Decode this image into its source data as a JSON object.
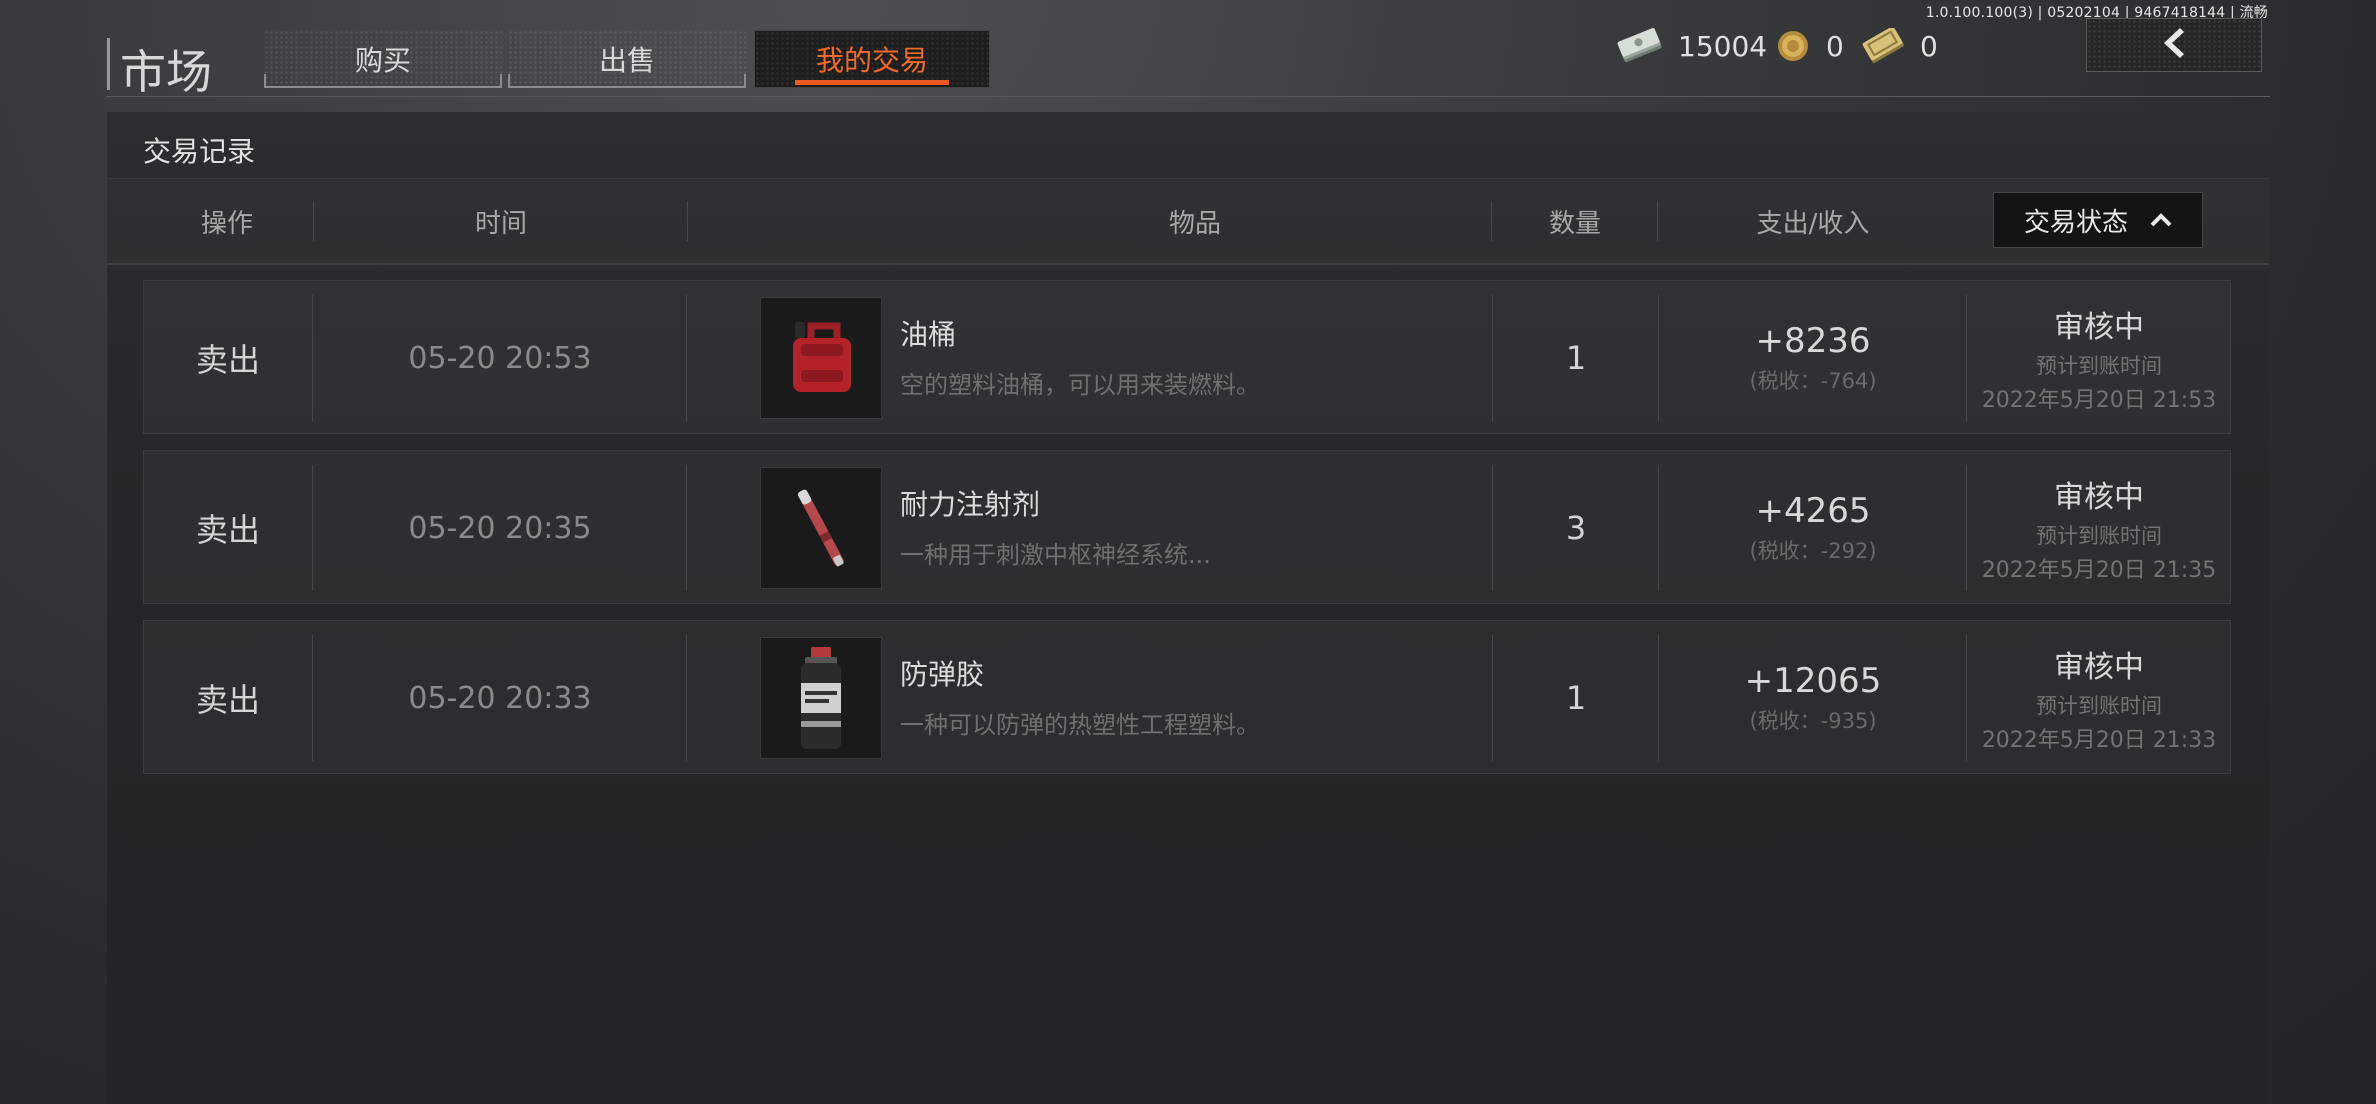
{
  "version_text": "1.0.100.100(3) | 05202104 | 9467418144 | 流畅",
  "header": {
    "title": "市场",
    "tabs": [
      {
        "label": "购买",
        "active": false
      },
      {
        "label": "出售",
        "active": false
      },
      {
        "label": "我的交易",
        "active": true
      }
    ],
    "currencies": [
      {
        "icon": "cash-stack-icon",
        "value": "15004"
      },
      {
        "icon": "gold-coin-icon",
        "value": "0"
      },
      {
        "icon": "gold-bill-icon",
        "value": "0"
      }
    ],
    "back_icon": "chevron-left-icon"
  },
  "panel": {
    "title": "交易记录",
    "columns": {
      "action": "操作",
      "time": "时间",
      "item": "物品",
      "quantity": "数量",
      "amount": "支出/收入",
      "status_filter": "交易状态"
    },
    "rows": [
      {
        "action": "卖出",
        "time": "05-20 20:53",
        "item_name": "油桶",
        "item_desc": "空的塑料油桶，可以用来装燃料。",
        "item_icon": "fuel-can-icon",
        "quantity": "1",
        "amount": "+8236",
        "tax": "(税收：-764)",
        "status": "审核中",
        "status_sub": "预计到账时间",
        "status_date": "2022年5月20日 21:53"
      },
      {
        "action": "卖出",
        "time": "05-20 20:35",
        "item_name": "耐力注射剂",
        "item_desc": "一种用于刺激中枢神经系统...",
        "item_icon": "injector-icon",
        "quantity": "3",
        "amount": "+4265",
        "tax": "(税收：-292)",
        "status": "审核中",
        "status_sub": "预计到账时间",
        "status_date": "2022年5月20日 21:35"
      },
      {
        "action": "卖出",
        "time": "05-20 20:33",
        "item_name": "防弹胶",
        "item_desc": "一种可以防弹的热塑性工程塑料。",
        "item_icon": "glue-bottle-icon",
        "quantity": "1",
        "amount": "+12065",
        "tax": "(税收：-935)",
        "status": "审核中",
        "status_sub": "预计到账时间",
        "status_date": "2022年5月20日 21:33"
      }
    ]
  },
  "colors": {
    "accent": "#e85a21",
    "accent_text": "#f06a2b"
  }
}
